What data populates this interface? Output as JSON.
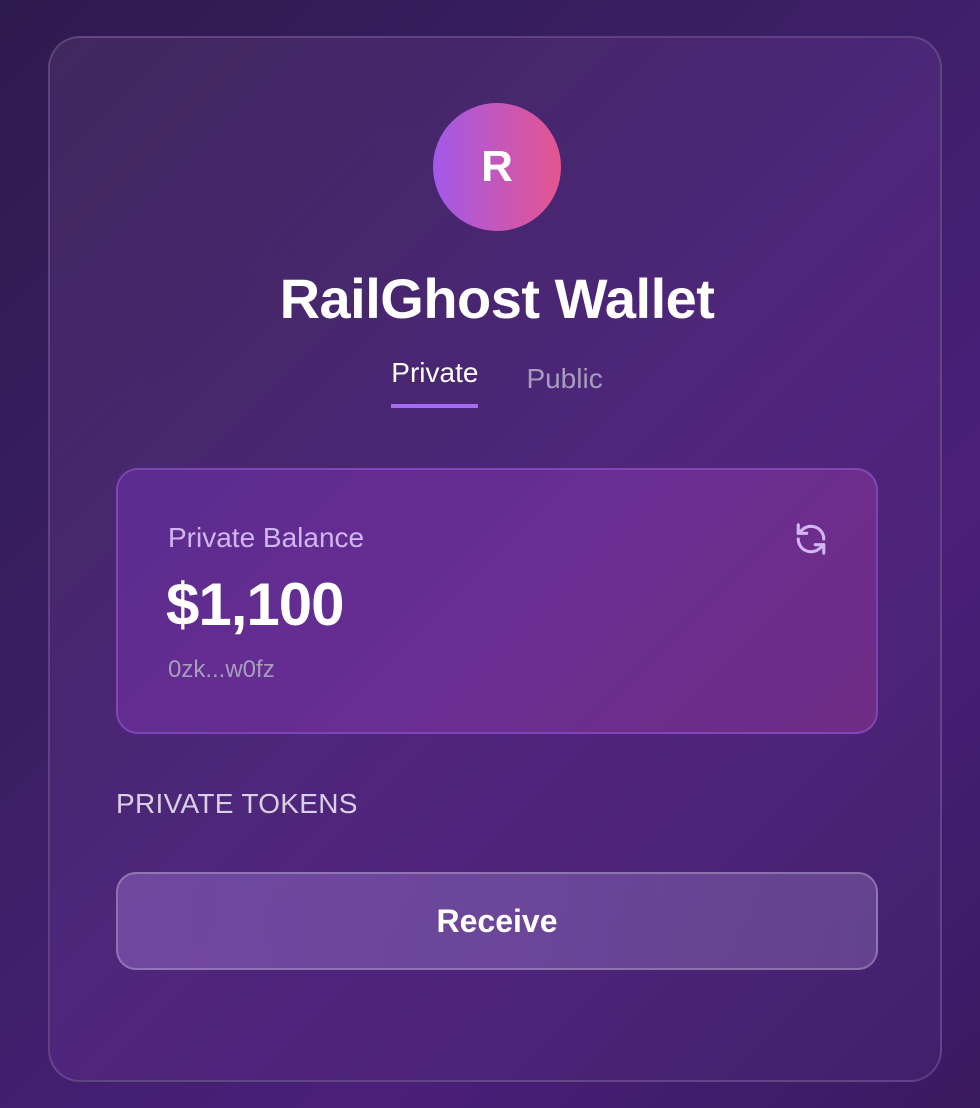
{
  "wallet": {
    "avatar_initial": "R",
    "title": "RailGhost Wallet"
  },
  "tabs": [
    {
      "label": "Private",
      "active": true
    },
    {
      "label": "Public",
      "active": false
    }
  ],
  "balance": {
    "label": "Private Balance",
    "value": "$1,100",
    "address": "0zk...w0fz",
    "refresh_icon": "refresh-icon"
  },
  "tokens_section": {
    "title": "PRIVATE TOKENS"
  },
  "actions": {
    "receive_label": "Receive"
  },
  "colors": {
    "accent": "#a56bf5",
    "avatar_gradient_start": "#a259e8",
    "avatar_gradient_end": "#e5558f",
    "balance_label": "#d2b5f3"
  }
}
